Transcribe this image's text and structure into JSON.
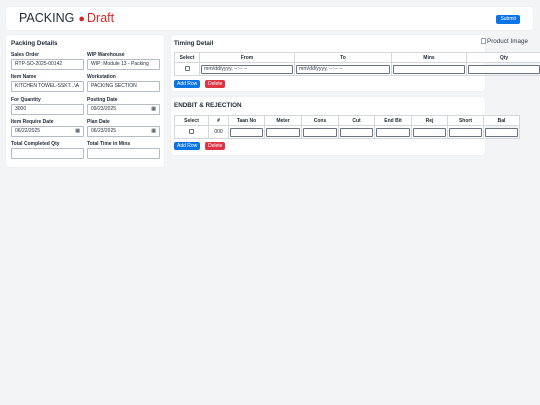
{
  "header": {
    "title": "PACKING",
    "status": "Draft",
    "submit_label": "Submit"
  },
  "packing_details": {
    "title": "Packing Details",
    "fields": [
      {
        "label": "Sales Order",
        "value": "RTP-SO-2025-00142"
      },
      {
        "label": "WIP Warehouse",
        "value": "WIP: Module 13 - Packing"
      },
      {
        "label": "Item Name",
        "value": "KITCHEN TOWEL-SSKT...\\A"
      },
      {
        "label": "Workstation",
        "value": "PACKING SECTION"
      },
      {
        "label": "For Quantity",
        "value": "3000"
      },
      {
        "label": "Posting Date",
        "value": "09/23/2025"
      },
      {
        "label": "Item Require Date",
        "value": "06/22/2025"
      },
      {
        "label": "Plan Date",
        "value": "06/23/2025"
      },
      {
        "label": "Total Completed Qty",
        "value": ""
      },
      {
        "label": "Total Time in Mins",
        "value": ""
      }
    ]
  },
  "timing_detail": {
    "title": "Timing Detail",
    "columns": [
      "Select",
      "From",
      "To",
      "Mins",
      "Qty"
    ],
    "row": {
      "from": "mm/dd/yyyy, --:-- --",
      "to": "mm/dd/yyyy, --:-- --",
      "mins": "",
      "qty": ""
    },
    "add_row_label": "Add Row",
    "delete_label": "Delete"
  },
  "endbit": {
    "title": "ENDBIT & REJECTION",
    "columns": [
      "Select",
      "#",
      "Taan No",
      "Meter",
      "Cons",
      "Cut",
      "End Bit",
      "Rej",
      "Short",
      "Bal"
    ],
    "row": {
      "num": "000"
    },
    "add_row_label": "Add Row",
    "delete_label": "Delete"
  },
  "product_image": {
    "alt": "Product Image",
    "icon": "broken-image-icon"
  },
  "colors": {
    "accent": "#0b74e5",
    "danger": "#dc3545",
    "status": "#dc2626",
    "background": "#f3f4f6"
  }
}
